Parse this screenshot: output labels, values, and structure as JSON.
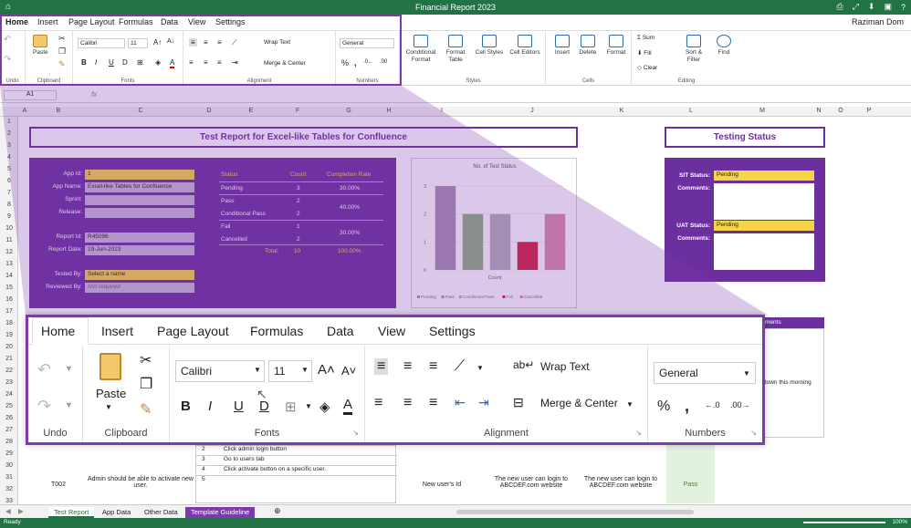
{
  "window": {
    "title": "Financial Report 2023",
    "user": "Raziman Dom"
  },
  "tabs": [
    "Home",
    "Insert",
    "Page Layout",
    "Formulas",
    "Data",
    "View",
    "Settings"
  ],
  "ribbon": {
    "undo_label": "Undo",
    "clipboard_label": "Clipboard",
    "paste": "Paste",
    "fonts_label": "Fonts",
    "font_name": "Calibri",
    "font_size": "11",
    "alignment_label": "Alignment",
    "wrap_text": "Wrap Text",
    "merge_center": "Merge & Center",
    "numbers_label": "Numbers",
    "number_format": "General",
    "styles_label": "Styles",
    "cells_label": "Cells",
    "editing_label": "Editing",
    "cond_format": "Conditional Format",
    "format_table": "Format Table",
    "cell_styles": "Cell Styles",
    "cell_editors": "Cell Editors",
    "insert": "Insert",
    "delete": "Delete",
    "format": "Format",
    "sum": "Sum",
    "fill": "Fill",
    "clear": "Clear",
    "sort_filter": "Sort & Filter",
    "find": "Find"
  },
  "formula": {
    "cell_ref": "A1",
    "fx": "fx"
  },
  "columns": [
    "A",
    "B",
    "C",
    "D",
    "E",
    "F",
    "G",
    "H",
    "I",
    "J",
    "K",
    "L",
    "M",
    "N",
    "O",
    "P"
  ],
  "rows": [
    "1",
    "2",
    "3",
    "4",
    "5",
    "6",
    "7",
    "8",
    "9",
    "10",
    "11",
    "12",
    "13",
    "14",
    "15",
    "16",
    "17",
    "18",
    "19",
    "20",
    "21",
    "22",
    "23",
    "24",
    "25",
    "26",
    "27",
    "28",
    "29",
    "30",
    "31",
    "32",
    "33"
  ],
  "report": {
    "title": "Test Report for Excel-like Tables for Confluence",
    "app_id_label": "App Id:",
    "app_id": "1",
    "app_name_label": "App Name:",
    "app_name": "Excel-like Tables for Confluence",
    "sprint_label": "Sprint:",
    "release_label": "Release:",
    "report_id_label": "Report Id:",
    "report_id": "R45096",
    "report_date_label": "Report Date:",
    "report_date": "19-Jun-2023",
    "tested_by_label": "Tested By:",
    "tested_by": "Select a name",
    "reviewed_by_label": "Reviewed By:",
    "reviewed_by": "Not required",
    "status_hdr": "Status",
    "count_hdr": "Count",
    "rate_hdr": "Completion Rate",
    "status_rows": [
      {
        "status": "Pending",
        "count": "3",
        "rate": "30.00%"
      },
      {
        "status": "Pass",
        "count": "2",
        "rate": "40.00%"
      },
      {
        "status": "Conditional Pass",
        "count": "2",
        "rate": ""
      },
      {
        "status": "Fail",
        "count": "1",
        "rate": "30.00%"
      },
      {
        "status": "Cancelled",
        "count": "2",
        "rate": ""
      }
    ],
    "total_label": "Total:",
    "total_count": "10",
    "total_rate": "100.00%"
  },
  "testing": {
    "title": "Testing Status",
    "sit_label": "SIT Status:",
    "sit_value": "Pending",
    "comments_label": "Comments:",
    "uat_label": "UAT Status:",
    "uat_value": "Pending"
  },
  "chart_data": {
    "type": "bar",
    "title": "No. of Test Status",
    "xlabel": "Count",
    "ylabel": "",
    "categories": [
      "Pending",
      "Pass",
      "Conditional Pass",
      "Fail",
      "Cancelled"
    ],
    "values": [
      3,
      2,
      2,
      1,
      2
    ],
    "ylim": [
      0,
      3
    ],
    "colors": [
      "#a591b0",
      "#8db17e",
      "#b3b0b8",
      "#d0203f",
      "#d98cac"
    ],
    "yticks": [
      "0",
      "1",
      "2",
      "3"
    ],
    "legend": [
      "Pending",
      "Pass",
      "Conditional Pass",
      "Fail",
      "Cancelled"
    ]
  },
  "testcase": {
    "ments": "ments",
    "down": "down this morning",
    "steps": [
      {
        "n": "2",
        "t": "Click admin login button"
      },
      {
        "n": "3",
        "t": "Go to users tab"
      },
      {
        "n": "4",
        "t": "Click activate button on a specific user."
      },
      {
        "n": "5",
        "t": ""
      }
    ],
    "id": "T002",
    "desc": "Admin should be able to activate new user.",
    "data": "New user's Id",
    "expected": "The new user can login to ABCDEF.com website",
    "actual": "The new user can login to ABCDEF.com website",
    "result": "Pass"
  },
  "sheets": [
    "Test Report",
    "App Data",
    "Other Data",
    "Template Guideline"
  ],
  "status": {
    "ready": "Ready",
    "zoom": "100%"
  }
}
